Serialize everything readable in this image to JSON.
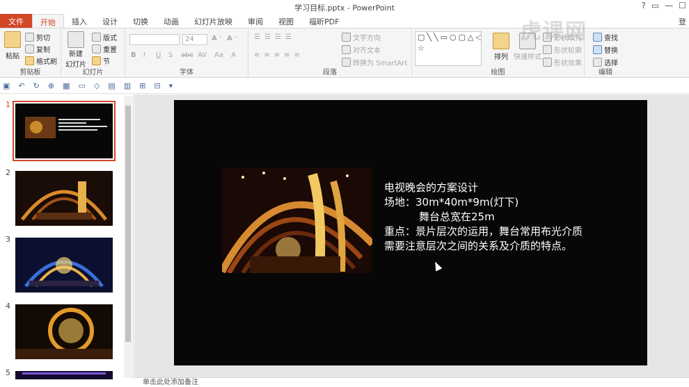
{
  "window": {
    "title": "学习目标.pptx - PowerPoint",
    "help": "?",
    "sign_in": "登"
  },
  "tabs": [
    "文件",
    "开始",
    "插入",
    "设计",
    "切换",
    "动画",
    "幻灯片放映",
    "审阅",
    "视图",
    "福昕PDF"
  ],
  "ribbon": {
    "clipboard": {
      "paste": "粘贴",
      "cut": "剪切",
      "copy": "复制",
      "format_painter": "格式刷",
      "label": "剪贴板"
    },
    "slides": {
      "new_slide_line1": "新建",
      "new_slide_line2": "幻灯片",
      "layout": "版式",
      "reset": "重置",
      "section": "节",
      "label": "幻灯片"
    },
    "font": {
      "size": "24",
      "label": "字体"
    },
    "paragraph": {
      "text_direction": "文字方向",
      "align_text": "对齐文本",
      "smartart": "转换为 SmartArt",
      "label": "段落"
    },
    "drawing": {
      "arrange": "排列",
      "quick_styles": "快速样式",
      "shape_fill": "形状填充",
      "shape_outline": "形状轮廓",
      "shape_effects": "形状效果",
      "label": "绘图"
    },
    "editing": {
      "find": "查找",
      "replace": "替换",
      "select": "选择",
      "label": "编辑"
    }
  },
  "watermark": "虎课网",
  "thumbnails": [
    {
      "num": "1"
    },
    {
      "num": "2"
    },
    {
      "num": "3"
    },
    {
      "num": "4"
    },
    {
      "num": "5"
    }
  ],
  "slide": {
    "lines": [
      "电视晚会的方案设计",
      "场地：30m*40m*9m(灯下)",
      "舞台总宽在25m",
      "重点：景片层次的运用，舞台常用布光介质",
      "需要注意层次之间的关系及介质的特点。"
    ]
  },
  "notes_placeholder": "单击此处添加备注",
  "colors": {
    "accent": "#d24726",
    "slide_bg": "#070707"
  }
}
